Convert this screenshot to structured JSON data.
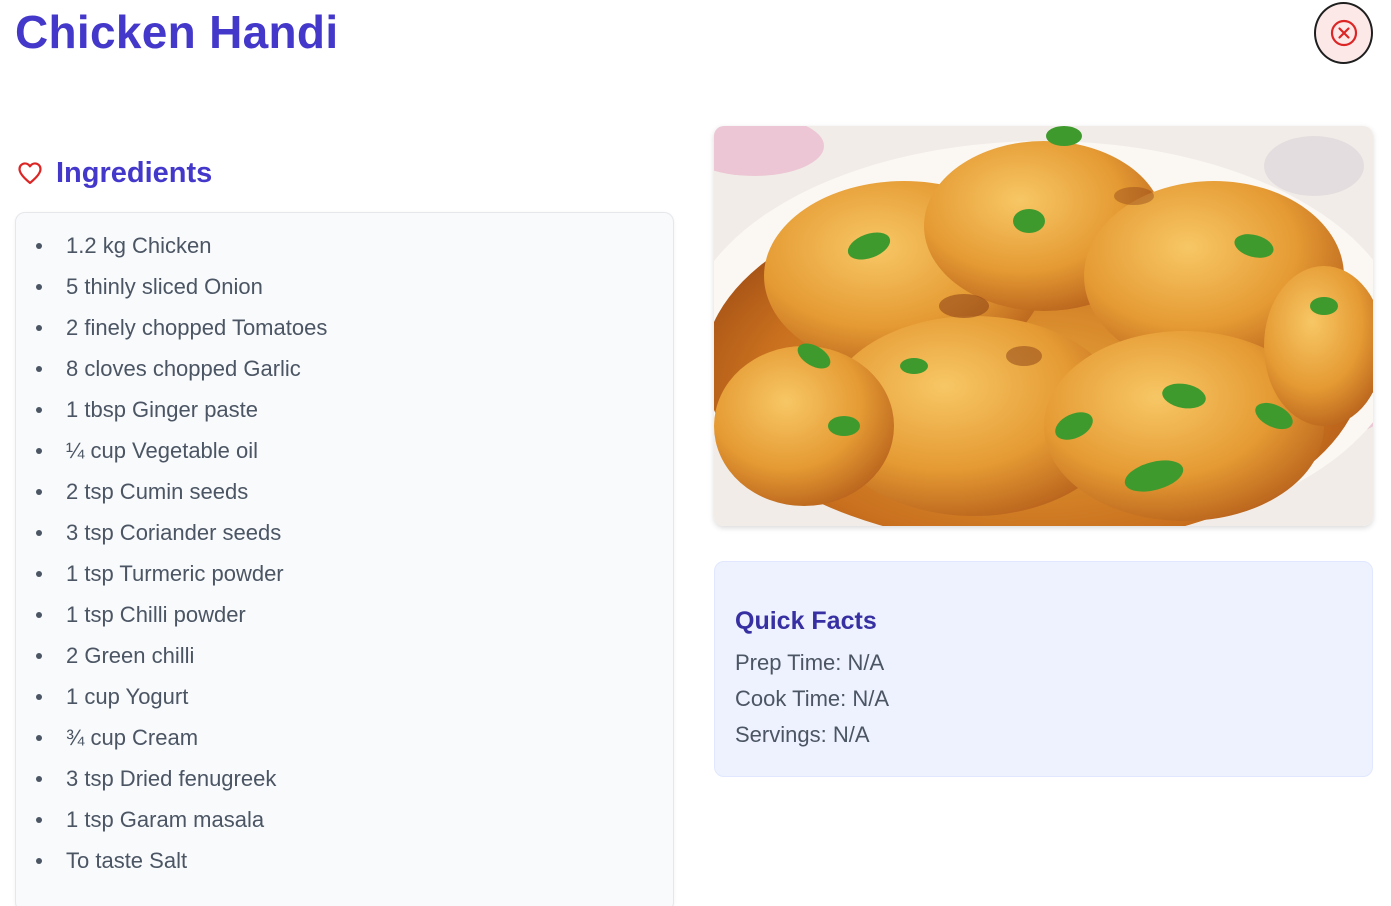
{
  "recipe": {
    "title": "Chicken Handi",
    "image_alt": "Chicken Handi"
  },
  "ingredients": {
    "heading": "Ingredients",
    "items": [
      "1.2 kg Chicken",
      "5 thinly sliced Onion",
      "2 finely chopped Tomatoes",
      "8 cloves chopped Garlic",
      "1 tbsp Ginger paste",
      "¼ cup Vegetable oil",
      "2 tsp Cumin seeds",
      "3 tsp Coriander seeds",
      "1 tsp Turmeric powder",
      "1 tsp Chilli powder",
      "2 Green chilli",
      "1 cup Yogurt",
      "¾ cup Cream",
      "3 tsp Dried fenugreek",
      "1 tsp Garam masala",
      "To taste Salt"
    ]
  },
  "quick_facts": {
    "heading": "Quick Facts",
    "prep": "Prep Time: N/A",
    "cook": "Cook Time: N/A",
    "servings": "Servings: N/A"
  },
  "colors": {
    "accent": "#4338ca",
    "close": "#dc2626",
    "facts_bg": "#eef2ff",
    "card_bg": "#f8fafc"
  },
  "icons": {
    "close": "close-circle-icon",
    "ingredients": "heart-icon"
  }
}
